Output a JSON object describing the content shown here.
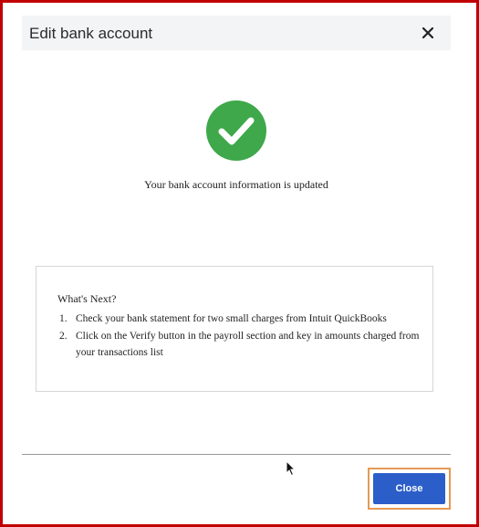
{
  "dialog": {
    "title": "Edit bank account",
    "close_icon": "close-icon"
  },
  "status": {
    "icon": "checkmark-circle-icon",
    "color": "#3ea84a",
    "message": "Your bank account information is updated"
  },
  "next_steps": {
    "heading": "What's Next?",
    "items": [
      {
        "num": "1.",
        "text": "Check your bank statement for two small charges from Intuit QuickBooks"
      },
      {
        "num": "2.",
        "text": "Click on the Verify button in the payroll section and key in amounts charged from your transactions list"
      }
    ]
  },
  "footer": {
    "close_label": "Close",
    "accent": "#2b5ec9",
    "highlight": "#e59a54"
  }
}
